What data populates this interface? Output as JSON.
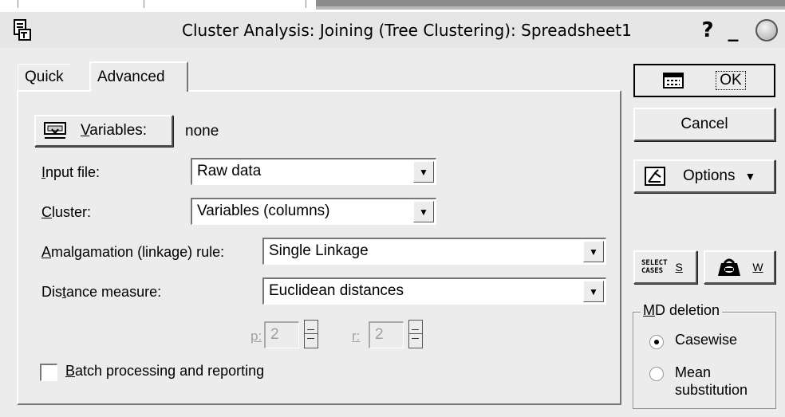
{
  "window": {
    "title": "Cluster Analysis: Joining (Tree Clustering): Spreadsheet1",
    "help_label": "?",
    "minimize_label": "_"
  },
  "tabs": [
    {
      "label": "Quick",
      "selected": false
    },
    {
      "label": "Advanced",
      "selected": true
    }
  ],
  "variables": {
    "button_key": "V",
    "button_rest": "ariables:",
    "value": "none"
  },
  "input_file": {
    "key": "I",
    "rest": "nput file:",
    "value": "Raw data"
  },
  "cluster": {
    "key": "C",
    "rest": "luster:",
    "value": "Variables (columns)"
  },
  "amalgamation": {
    "key": "A",
    "rest": "malgamation (linkage) rule:",
    "value": "Single Linkage"
  },
  "distance": {
    "pre": "Dis",
    "key": "t",
    "rest": "ance measure:",
    "value": "Euclidean distances"
  },
  "spinners": [
    {
      "label": "p:",
      "value": "2"
    },
    {
      "label": "r:",
      "value": "2"
    }
  ],
  "batch": {
    "key": "B",
    "rest": "atch processing and reporting",
    "checked": false
  },
  "buttons": {
    "ok": "OK",
    "cancel": "Cancel",
    "options": "Options",
    "select_cases_line1": "SELECT",
    "select_cases_line2": "CASES",
    "select_cases_key": "S",
    "weight_key": "W"
  },
  "md_deletion": {
    "title_key": "M",
    "title_rest": "D deletion",
    "options": [
      {
        "label": "Casewise",
        "selected": true
      },
      {
        "label": "Mean substitution",
        "selected": false
      }
    ]
  }
}
